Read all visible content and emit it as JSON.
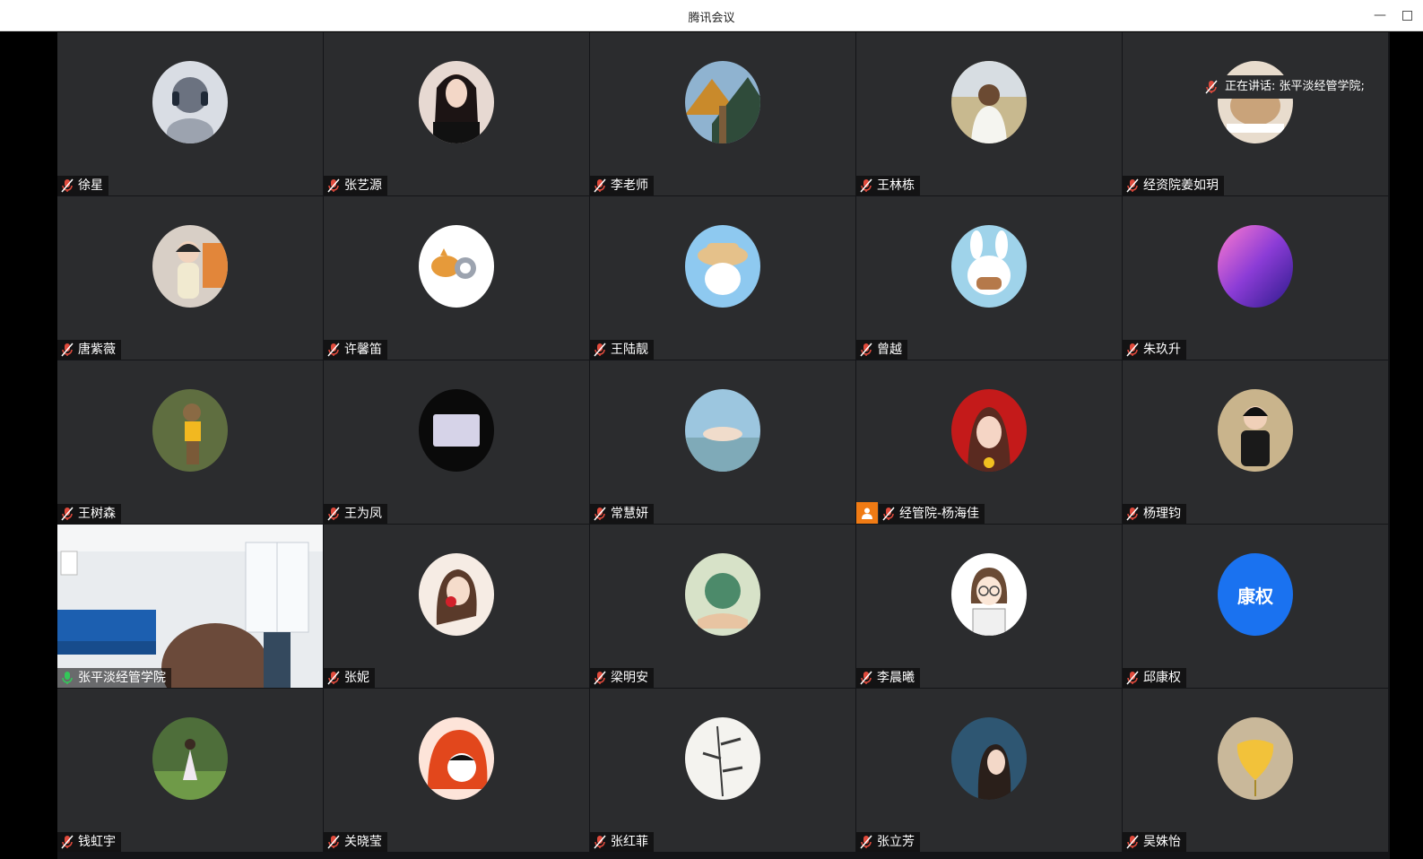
{
  "window": {
    "title": "腾讯会议",
    "minimize_icon": "minimize-icon",
    "maximize_icon": "maximize-icon"
  },
  "speaking_indicator": {
    "text": "正在讲话: 张平淡经管学院;"
  },
  "participants": [
    {
      "name": "徐星",
      "mic": "muted",
      "avatar": "anime-headphones"
    },
    {
      "name": "张艺源",
      "mic": "muted",
      "avatar": "portrait-dark"
    },
    {
      "name": "李老师",
      "mic": "muted",
      "avatar": "mountain-path"
    },
    {
      "name": "王林栋",
      "mic": "muted",
      "avatar": "woman-back"
    },
    {
      "name": "经资院姜如玥",
      "mic": "muted",
      "avatar": "pet-photo"
    },
    {
      "name": "唐紫薇",
      "mic": "muted",
      "avatar": "child-photo"
    },
    {
      "name": "许馨笛",
      "mic": "muted",
      "avatar": "cartoon-dog"
    },
    {
      "name": "王陆靓",
      "mic": "muted",
      "avatar": "hat-bear"
    },
    {
      "name": "曾越",
      "mic": "muted",
      "avatar": "cartoon-bunny"
    },
    {
      "name": "朱玖升",
      "mic": "muted",
      "avatar": "gradient-wave"
    },
    {
      "name": "王树森",
      "mic": "muted",
      "avatar": "groot-figure"
    },
    {
      "name": "王为凤",
      "mic": "muted",
      "avatar": "black-device"
    },
    {
      "name": "常慧妍",
      "mic": "muted",
      "avatar": "hands-sea"
    },
    {
      "name": "经管院-杨海佳",
      "mic": "muted",
      "avatar": "girl-red",
      "host": true
    },
    {
      "name": "杨理钧",
      "mic": "muted",
      "avatar": "kid-pose"
    },
    {
      "name": "张平淡经管学院",
      "mic": "active",
      "avatar": "video-room",
      "video": true
    },
    {
      "name": "张妮",
      "mic": "muted",
      "avatar": "girl-rose"
    },
    {
      "name": "梁明安",
      "mic": "muted",
      "avatar": "globe-hand"
    },
    {
      "name": "李晨曦",
      "mic": "muted",
      "avatar": "cartoon-girl-glasses"
    },
    {
      "name": "邱康权",
      "mic": "muted",
      "avatar": "text",
      "avatar_text": "康权"
    },
    {
      "name": "钱虹宇",
      "mic": "muted",
      "avatar": "girl-field"
    },
    {
      "name": "关晓莹",
      "mic": "muted",
      "avatar": "cartoon-red-hood"
    },
    {
      "name": "张红菲",
      "mic": "muted",
      "avatar": "bamboo-ink"
    },
    {
      "name": "张立芳",
      "mic": "muted",
      "avatar": "girl-sea"
    },
    {
      "name": "吴姝怡",
      "mic": "muted",
      "avatar": "ginkgo-leaf"
    }
  ],
  "colors": {
    "tile_bg": "#2b2c2e",
    "muted_mic": "#e04a3c",
    "active_mic": "#34c759",
    "speaking_border": "#28c76f",
    "host_badge": "#f07b14",
    "text_avatar": "#1a72f0"
  }
}
